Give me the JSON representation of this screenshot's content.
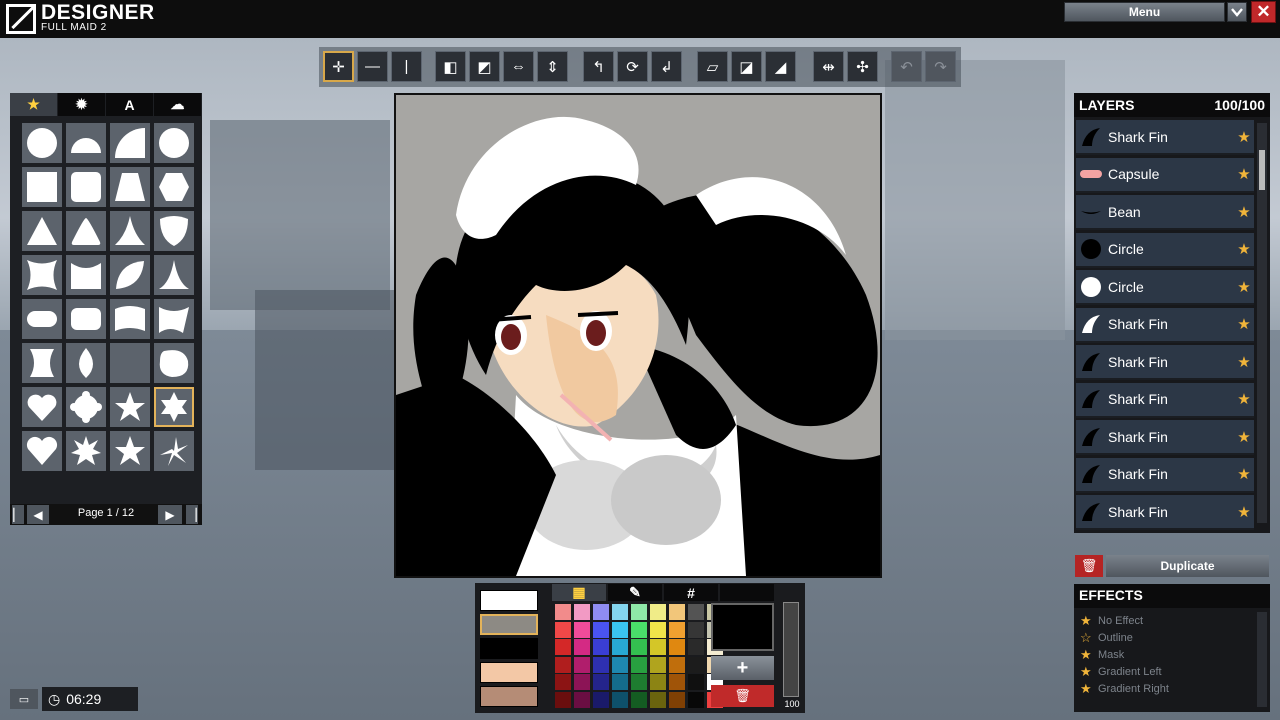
{
  "app": {
    "title": "DESIGNER",
    "subtitle": "FULL MAID 2"
  },
  "window": {
    "menu_label": "Menu",
    "minimize_icon": "chevron-down-icon",
    "close_icon": "close-icon"
  },
  "toolbar": {
    "tools": [
      "move-icon",
      "flip-horizontal-icon",
      "flip-vertical-icon",
      "align-1-icon",
      "align-2-icon",
      "stretch-h-icon",
      "stretch-v-icon",
      "rotate-left-icon",
      "rotate-icon",
      "rotate-right-icon",
      "skew-1-icon",
      "skew-2-icon",
      "skew-3-icon",
      "scale-h-icon",
      "scale-v-icon",
      "undo-icon",
      "redo-icon"
    ]
  },
  "shapes": {
    "tabs": [
      "★",
      "✹",
      "A",
      "☁"
    ],
    "page_label": "Page 1 / 12"
  },
  "layers": {
    "title": "LAYERS",
    "count": "100/100",
    "items": [
      {
        "label": "Shark Fin",
        "icon": "shark-fin-icon",
        "icon_color": "#000000"
      },
      {
        "label": "Capsule",
        "icon": "capsule-icon",
        "icon_color": "#f4a3a3"
      },
      {
        "label": "Bean",
        "icon": "bean-icon",
        "icon_color": "#000000"
      },
      {
        "label": "Circle",
        "icon": "circle-icon",
        "icon_color": "#000000"
      },
      {
        "label": "Circle",
        "icon": "circle-icon",
        "icon_color": "#ffffff"
      },
      {
        "label": "Shark Fin",
        "icon": "shark-fin-icon",
        "icon_color": "#ffffff"
      },
      {
        "label": "Shark Fin",
        "icon": "shark-fin-icon",
        "icon_color": "#000000"
      },
      {
        "label": "Shark Fin",
        "icon": "shark-fin-icon",
        "icon_color": "#000000"
      },
      {
        "label": "Shark Fin",
        "icon": "shark-fin-icon",
        "icon_color": "#000000"
      },
      {
        "label": "Shark Fin",
        "icon": "shark-fin-icon",
        "icon_color": "#000000"
      },
      {
        "label": "Shark Fin",
        "icon": "shark-fin-icon",
        "icon_color": "#000000"
      }
    ],
    "duplicate_label": "Duplicate"
  },
  "effects": {
    "title": "EFFECTS",
    "items": [
      "No Effect",
      "Outline",
      "Mask",
      "Gradient Left",
      "Gradient Right"
    ]
  },
  "colors": {
    "recent_swatches": [
      "#ffffff",
      "#8d8a84",
      "#000000",
      "#f3c8a6",
      "#b58c76"
    ],
    "tabs": [
      "palette-icon",
      "eyedropper-icon",
      "#",
      ""
    ],
    "palette": [
      [
        "#f28b8b",
        "#f29ac4",
        "#8f8cf2",
        "#84d6f0",
        "#8ee8a8",
        "#f0ec88",
        "#f2c67a",
        "#545454",
        "#c9c7a4"
      ],
      [
        "#f04848",
        "#f04c9a",
        "#4a54f0",
        "#3ac4f0",
        "#4ade6a",
        "#f0e44a",
        "#f0a030",
        "#363636",
        "#c4c4b0"
      ],
      [
        "#d42828",
        "#d42a84",
        "#3a3ed4",
        "#28a8d4",
        "#34c050",
        "#d4c628",
        "#e08810",
        "#2a2a2a",
        "#f4ecd2"
      ],
      [
        "#b01e1e",
        "#b01e6c",
        "#2e30b0",
        "#1e88b0",
        "#28a040",
        "#b0a41e",
        "#c06e0c",
        "#1c1c1c",
        "#f0d8b0"
      ],
      [
        "#8c1414",
        "#8c1456",
        "#24248c",
        "#146c8c",
        "#1e7c30",
        "#8c8414",
        "#a05408",
        "#101010",
        "#ffffff"
      ],
      [
        "#6a0e0e",
        "#6a0e42",
        "#1a1a6a",
        "#0e506a",
        "#145c22",
        "#6a640e",
        "#804004",
        "#080808",
        "#f04040"
      ]
    ],
    "preview_color": "#000000",
    "alpha_value": "100"
  },
  "status": {
    "time": "06:29"
  }
}
